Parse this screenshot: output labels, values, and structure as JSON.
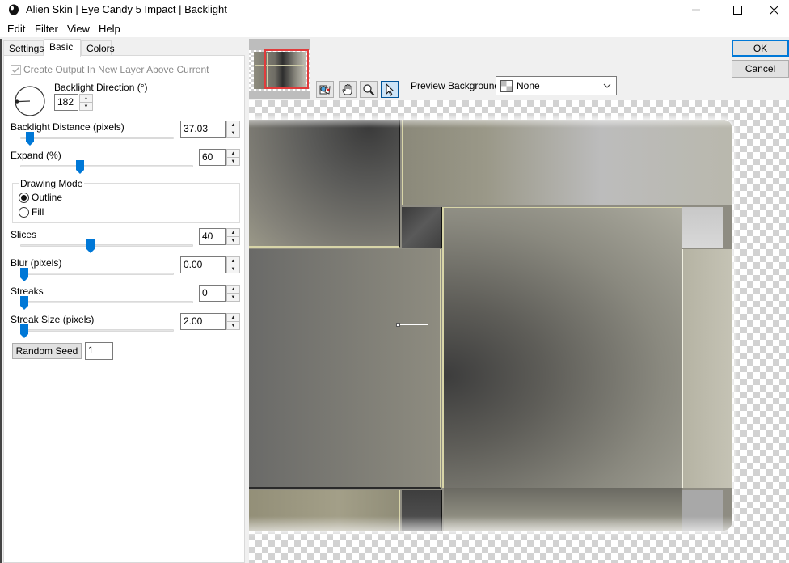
{
  "window": {
    "title": "Alien Skin | Eye Candy 5 Impact | Backlight",
    "controls": {
      "minimize": "minimize-icon",
      "maximize": "maximize-icon",
      "close": "close-icon"
    }
  },
  "menu": {
    "items": [
      "Edit",
      "Filter",
      "View",
      "Help"
    ]
  },
  "tabs": [
    {
      "label": "Settings",
      "active": false
    },
    {
      "label": "Basic",
      "active": true
    },
    {
      "label": "Colors",
      "active": false
    }
  ],
  "basic": {
    "create_output_label": "Create Output In New Layer Above Current",
    "create_output_checked": true,
    "direction": {
      "label": "Backlight Direction (°)",
      "value": "182"
    },
    "distance": {
      "label": "Backlight Distance (pixels)",
      "value": "37.03",
      "slider_fraction": 0.04
    },
    "expand": {
      "label": "Expand (%)",
      "value": "60",
      "slider_fraction": 0.34
    },
    "drawing_mode": {
      "label": "Drawing Mode",
      "options": [
        {
          "label": "Outline",
          "selected": true
        },
        {
          "label": "Fill",
          "selected": false
        }
      ]
    },
    "slices": {
      "label": "Slices",
      "value": "40",
      "slider_fraction": 0.4
    },
    "blur": {
      "label": "Blur (pixels)",
      "value": "0.00",
      "slider_fraction": 0.0
    },
    "streaks": {
      "label": "Streaks",
      "value": "0",
      "slider_fraction": 0.0
    },
    "streak_size": {
      "label": "Streak Size (pixels)",
      "value": "2.00",
      "slider_fraction": 0.0
    },
    "random_seed": {
      "button_label": "Random Seed",
      "value": "1"
    }
  },
  "toolbar": {
    "tools": [
      "compare-icon",
      "hand-icon",
      "zoom-icon",
      "pointer-icon"
    ],
    "active_tool": "pointer-icon",
    "preview_background_label": "Preview Background:",
    "preview_background_value": "None"
  },
  "actions": {
    "ok": "OK",
    "cancel": "Cancel"
  },
  "colors": {
    "accent": "#0078d7",
    "nav_frame": "#e03c3c"
  }
}
